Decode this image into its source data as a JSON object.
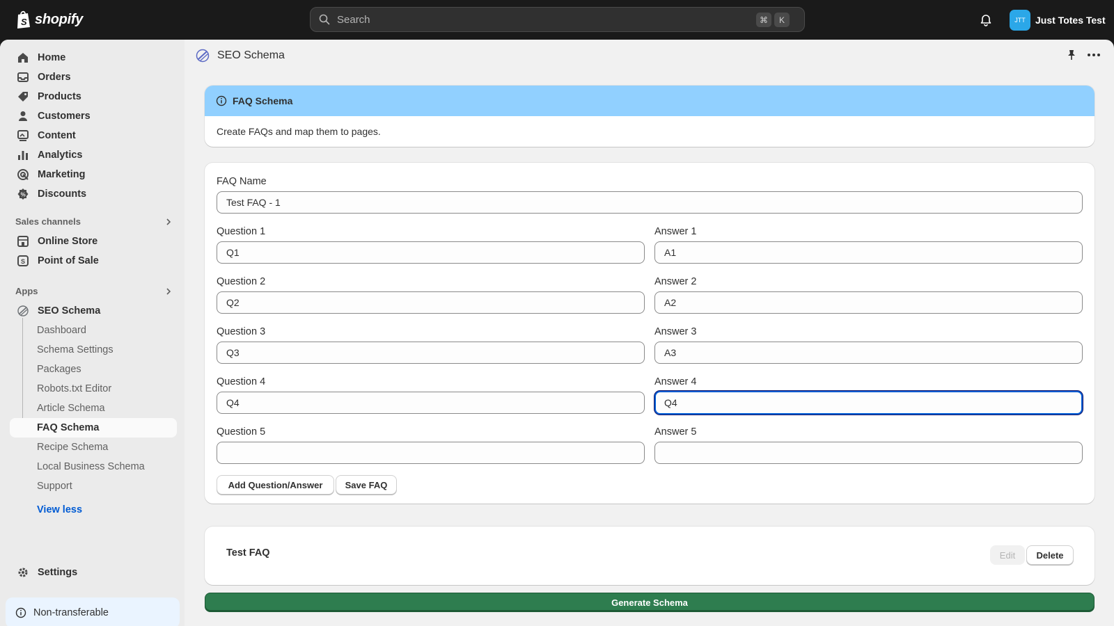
{
  "topbar": {
    "brand": "shopify",
    "search_placeholder": "Search",
    "kbd_cmd": "⌘",
    "kbd_k": "K",
    "avatar_initials": "JTT",
    "store_name": "Just Totes Test"
  },
  "sidebar": {
    "main_items": [
      {
        "label": "Home",
        "icon": "home-icon"
      },
      {
        "label": "Orders",
        "icon": "inbox-icon"
      },
      {
        "label": "Products",
        "icon": "tag-icon"
      },
      {
        "label": "Customers",
        "icon": "person-icon"
      },
      {
        "label": "Content",
        "icon": "content-icon"
      },
      {
        "label": "Analytics",
        "icon": "bar-chart-icon"
      },
      {
        "label": "Marketing",
        "icon": "target-icon"
      },
      {
        "label": "Discounts",
        "icon": "discount-icon"
      }
    ],
    "sales_channels_label": "Sales channels",
    "sales_channels": [
      {
        "label": "Online Store",
        "icon": "store-icon"
      },
      {
        "label": "Point of Sale",
        "icon": "pos-icon"
      }
    ],
    "apps_label": "Apps",
    "app": {
      "label": "SEO Schema",
      "icon": "seo-schema-icon"
    },
    "app_sub_items": [
      "Dashboard",
      "Schema Settings",
      "Packages",
      "Robots.txt Editor",
      "Article Schema",
      "FAQ Schema",
      "Recipe Schema",
      "Local Business Schema",
      "Support"
    ],
    "active_sub_item": "FAQ Schema",
    "view_less": "View less",
    "settings": "Settings",
    "non_transferable": "Non-transferable"
  },
  "header": {
    "app_title": "SEO Schema"
  },
  "banner": {
    "title": "FAQ Schema",
    "description": "Create FAQs and map them to pages."
  },
  "form": {
    "faq_name_label": "FAQ Name",
    "faq_name_value": "Test FAQ - 1",
    "rows": [
      {
        "q_label": "Question 1",
        "q_value": "Q1",
        "a_label": "Answer 1",
        "a_value": "A1"
      },
      {
        "q_label": "Question 2",
        "q_value": "Q2",
        "a_label": "Answer 2",
        "a_value": "A2"
      },
      {
        "q_label": "Question 3",
        "q_value": "Q3",
        "a_label": "Answer 3",
        "a_value": "A3"
      },
      {
        "q_label": "Question 4",
        "q_value": "Q4",
        "a_label": "Answer 4",
        "a_value": "Q4"
      },
      {
        "q_label": "Question 5",
        "q_value": "",
        "a_label": "Answer 5",
        "a_value": ""
      }
    ],
    "add_button": "Add Question/Answer",
    "save_button": "Save FAQ"
  },
  "saved_faq": {
    "name": "Test FAQ",
    "edit_button": "Edit",
    "delete_button": "Delete"
  },
  "generate_button": "Generate Schema"
}
